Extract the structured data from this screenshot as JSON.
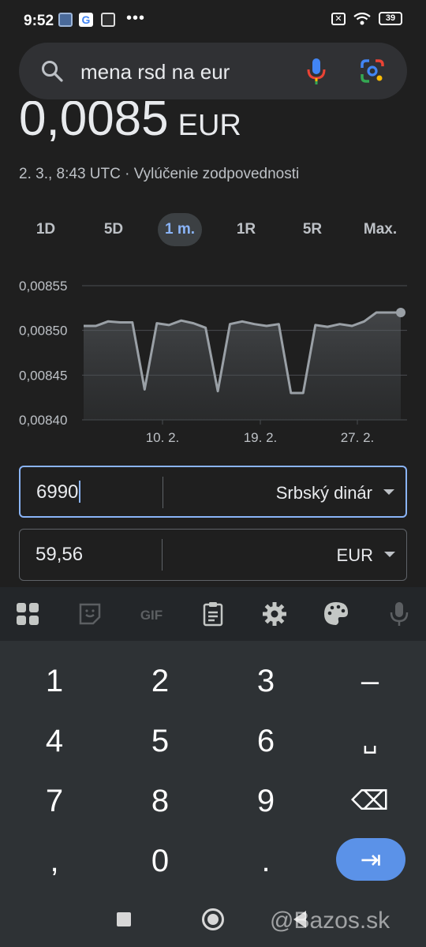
{
  "status_bar": {
    "time": "9:52",
    "battery": "39",
    "icons": [
      "app-tile-icon",
      "google-icon",
      "app-tile-icon",
      "more-icon",
      "x-box-icon",
      "wifi-icon",
      "battery-icon"
    ]
  },
  "search": {
    "query": "mena rsd na eur",
    "icons": [
      "search-icon",
      "mic-icon",
      "lens-icon"
    ]
  },
  "rate": {
    "value": "0,0085",
    "unit": "EUR",
    "meta": "2. 3., 8:43 UTC · Vylúčenie zodpovednosti"
  },
  "tabs": [
    {
      "label": "1D",
      "active": false
    },
    {
      "label": "5D",
      "active": false
    },
    {
      "label": "1 m.",
      "active": true
    },
    {
      "label": "1R",
      "active": false
    },
    {
      "label": "5R",
      "active": false
    },
    {
      "label": "Max.",
      "active": false
    }
  ],
  "chart_data": {
    "type": "area",
    "y_ticks": [
      "0,00855",
      "0,00850",
      "0,00845",
      "0,00840"
    ],
    "x_ticks": [
      "10. 2.",
      "19. 2.",
      "27. 2."
    ],
    "ylim": [
      0.0084,
      0.00855
    ],
    "values": [
      0.008505,
      0.008505,
      0.00851,
      0.008509,
      0.008509,
      0.008434,
      0.008508,
      0.008506,
      0.008511,
      0.008508,
      0.008503,
      0.008432,
      0.008507,
      0.00851,
      0.008507,
      0.008505,
      0.008507,
      0.00843,
      0.00843,
      0.008506,
      0.008504,
      0.008507,
      0.008505,
      0.00851,
      0.00852,
      0.00852,
      0.00852
    ]
  },
  "converter": {
    "from": {
      "value": "6990",
      "currency": "Srbský dinár"
    },
    "to": {
      "value": "59,56",
      "currency": "EUR"
    }
  },
  "keyboard_toolbar": [
    "grid-icon",
    "sticker-icon",
    "gif-icon",
    "clipboard-icon",
    "gear-icon",
    "palette-icon",
    "mic-icon"
  ],
  "keypad": {
    "row1": [
      "1",
      "2",
      "3",
      "–"
    ],
    "row2": [
      "4",
      "5",
      "6",
      "␣"
    ],
    "row3": [
      "7",
      "8",
      "9",
      "⌫"
    ],
    "row4": [
      ",",
      "0",
      ".",
      "⇥"
    ]
  },
  "watermark": "@Bazos.sk"
}
